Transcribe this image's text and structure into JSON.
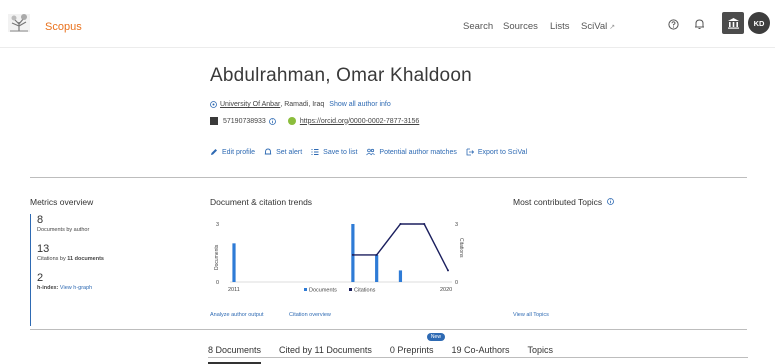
{
  "header": {
    "logo_text": "Scopus",
    "nav": [
      {
        "label": "Search"
      },
      {
        "label": "Sources"
      },
      {
        "label": "Lists"
      },
      {
        "label": "SciVal",
        "ext_icon": "↗"
      }
    ],
    "avatar_initials": "KD"
  },
  "author": {
    "name": "Abdulrahman, Omar Khaldoon",
    "affiliation": "University Of Anbar",
    "location": ", Ramadi, Iraq",
    "show_all_info": "Show all author info",
    "author_id": "57190738933",
    "orcid_url": "https://orcid.org/0000-0002-7877-3156"
  },
  "actions": [
    {
      "label": "Edit profile",
      "icon": "pencil-icon"
    },
    {
      "label": "Set alert",
      "icon": "bell-icon"
    },
    {
      "label": "Save to list",
      "icon": "list-icon"
    },
    {
      "label": "Potential author matches",
      "icon": "people-icon"
    },
    {
      "label": "Export to SciVal",
      "icon": "export-icon"
    }
  ],
  "metrics": {
    "title": "Metrics overview",
    "documents": {
      "value": "8",
      "label": "Documents by author"
    },
    "citations": {
      "value": "13",
      "label_prefix": "Citations by",
      "label_bold": "11 documents"
    },
    "hindex": {
      "value": "2",
      "label": "h-index:",
      "link": "View h-graph"
    }
  },
  "trends": {
    "title": "Document & citation trends",
    "analyze_link": "Analyze author output",
    "citation_link": "Citation overview"
  },
  "topics": {
    "title": "Most contributed Topics",
    "view_all": "View all Topics"
  },
  "chart_data": {
    "type": "bar",
    "x_start": "2011",
    "x_end": "2020",
    "left_axis_label": "Documents",
    "right_axis_label": "Citations",
    "left_ticks": [
      "3",
      "0"
    ],
    "right_ticks": [
      "3",
      "0"
    ],
    "ylim": [
      0,
      3
    ],
    "series": [
      {
        "name": "Documents",
        "type": "bar",
        "color": "#2e7bd6",
        "points": [
          {
            "x": 2011,
            "y": 2
          },
          {
            "x": 2016,
            "y": 3
          },
          {
            "x": 2017,
            "y": 1.4
          },
          {
            "x": 2018,
            "y": 0.6
          }
        ]
      },
      {
        "name": "Citations",
        "type": "line",
        "color": "#1b1f5e",
        "points": [
          {
            "x": 2016,
            "y": 1.4
          },
          {
            "x": 2017,
            "y": 1.4
          },
          {
            "x": 2018,
            "y": 3
          },
          {
            "x": 2019,
            "y": 3
          },
          {
            "x": 2020,
            "y": 0.6
          }
        ]
      }
    ]
  },
  "tabs": [
    {
      "label": "8 Documents",
      "active": true
    },
    {
      "label": "Cited by 11 Documents"
    },
    {
      "label": "0 Preprints",
      "badge": "New"
    },
    {
      "label": "19 Co-Authors"
    },
    {
      "label": "Topics"
    }
  ],
  "colors": {
    "accent": "#2e6ab3",
    "brand": "#e9711c",
    "bar": "#2e7bd6",
    "line": "#1b1f5e"
  }
}
